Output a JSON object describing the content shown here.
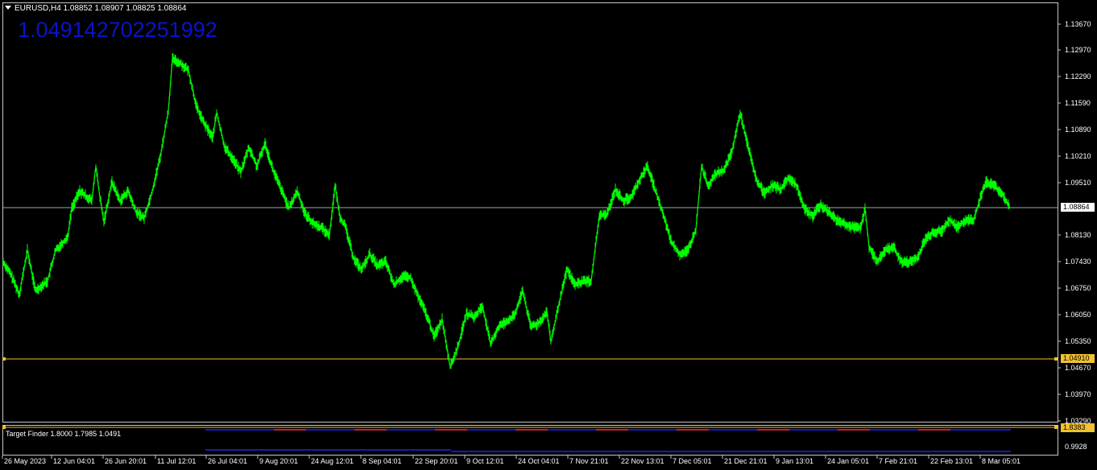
{
  "header": {
    "symbol_line": "EURUSD,H4  1.08852 1.08907 1.08825 1.08864",
    "big_value": "1.049142702251992"
  },
  "indicator": {
    "label": "Target Finder 1.8000 1.7985 1.0491"
  },
  "price_axis": {
    "labels": [
      "1.13670",
      "1.12970",
      "1.12290",
      "1.11590",
      "1.10890",
      "1.10210",
      "1.09510",
      "1.08130",
      "1.07430",
      "1.06750",
      "1.06050",
      "1.05350",
      "1.04670",
      "1.03970",
      "1.03290"
    ],
    "current_price": "1.08864",
    "target_price": "1.04910",
    "sub_tag": "1.8383",
    "sub_low": "0.9928"
  },
  "time_axis": {
    "labels": [
      "26 May 2023",
      "12 Jun 04:01",
      "26 Jun 20:01",
      "11 Jul 12:01",
      "26 Jul 04:01",
      "9 Aug 20:01",
      "24 Aug 12:01",
      "8 Sep 04:01",
      "22 Sep 20:01",
      "9 Oct 12:01",
      "24 Oct 04:01",
      "7 Nov 21:01",
      "22 Nov 13:01",
      "7 Dec 05:01",
      "21 Dec 21:01",
      "9 Jan 13:01",
      "24 Jan 05:01",
      "7 Feb 21:01",
      "22 Feb 13:01",
      "8 Mar 05:01"
    ]
  },
  "colors": {
    "background": "#000000",
    "price_line": "#00ff00",
    "current_line": "#a0a8b0",
    "target_line": "#f2c12e",
    "big_value": "#0a14c8",
    "indicator_blue": "#2020ff",
    "indicator_red": "#ff2020"
  },
  "chart_data": {
    "type": "line",
    "title": "EURUSD,H4",
    "series": [
      {
        "values": [
          [
            0,
            1.0745
          ],
          [
            10,
            1.071
          ],
          [
            20,
            1.066
          ],
          [
            30,
            1.0775
          ],
          [
            40,
            1.067
          ],
          [
            55,
            1.0695
          ],
          [
            65,
            1.0775
          ],
          [
            80,
            1.081
          ],
          [
            85,
            1.0885
          ],
          [
            95,
            1.093
          ],
          [
            110,
            1.0905
          ],
          [
            115,
            1.0995
          ],
          [
            120,
            1.0915
          ],
          [
            125,
            1.085
          ],
          [
            135,
            1.0955
          ],
          [
            145,
            1.0905
          ],
          [
            155,
            1.093
          ],
          [
            165,
            1.0875
          ],
          [
            175,
            1.086
          ],
          [
            185,
            1.093
          ],
          [
            195,
            1.102
          ],
          [
            205,
            1.114
          ],
          [
            210,
            1.1275
          ],
          [
            220,
            1.1265
          ],
          [
            230,
            1.1245
          ],
          [
            240,
            1.115
          ],
          [
            250,
            1.1105
          ],
          [
            260,
            1.107
          ],
          [
            265,
            1.1135
          ],
          [
            275,
            1.1045
          ],
          [
            285,
            1.1015
          ],
          [
            295,
            1.098
          ],
          [
            305,
            1.1045
          ],
          [
            315,
            1.0995
          ],
          [
            325,
            1.1055
          ],
          [
            335,
            1.0985
          ],
          [
            345,
            1.0935
          ],
          [
            355,
            1.0885
          ],
          [
            365,
            1.093
          ],
          [
            375,
            1.087
          ],
          [
            385,
            1.0845
          ],
          [
            395,
            1.0835
          ],
          [
            405,
            1.0815
          ],
          [
            412,
            1.0945
          ],
          [
            418,
            1.0865
          ],
          [
            425,
            1.0835
          ],
          [
            435,
            1.0755
          ],
          [
            445,
            1.0725
          ],
          [
            455,
            1.0765
          ],
          [
            465,
            1.0735
          ],
          [
            475,
            1.0745
          ],
          [
            485,
            1.0685
          ],
          [
            495,
            1.0705
          ],
          [
            505,
            1.0705
          ],
          [
            515,
            1.0655
          ],
          [
            525,
            1.061
          ],
          [
            535,
            1.055
          ],
          [
            545,
            1.0595
          ],
          [
            555,
            1.047
          ],
          [
            565,
            1.0525
          ],
          [
            575,
            1.061
          ],
          [
            585,
            1.06
          ],
          [
            595,
            1.063
          ],
          [
            605,
            1.053
          ],
          [
            615,
            1.0575
          ],
          [
            625,
            1.059
          ],
          [
            635,
            1.0605
          ],
          [
            645,
            1.067
          ],
          [
            655,
            1.0575
          ],
          [
            665,
            1.0585
          ],
          [
            675,
            1.0615
          ],
          [
            680,
            1.0535
          ],
          [
            690,
            1.0635
          ],
          [
            700,
            1.0725
          ],
          [
            710,
            1.0685
          ],
          [
            720,
            1.0695
          ],
          [
            730,
            1.0695
          ],
          [
            740,
            1.0865
          ],
          [
            750,
            1.087
          ],
          [
            760,
            1.0935
          ],
          [
            770,
            1.0905
          ],
          [
            780,
            1.0915
          ],
          [
            790,
            1.096
          ],
          [
            800,
            1.0995
          ],
          [
            810,
            1.093
          ],
          [
            820,
            1.0865
          ],
          [
            830,
            1.0795
          ],
          [
            840,
            1.0765
          ],
          [
            850,
            1.0775
          ],
          [
            860,
            1.083
          ],
          [
            867,
            1.0995
          ],
          [
            875,
            1.0945
          ],
          [
            885,
            1.0975
          ],
          [
            895,
            1.0985
          ],
          [
            905,
            1.1035
          ],
          [
            915,
            1.1135
          ],
          [
            925,
            1.1045
          ],
          [
            935,
            1.096
          ],
          [
            945,
            1.0925
          ],
          [
            955,
            1.0945
          ],
          [
            965,
            1.0935
          ],
          [
            975,
            1.0965
          ],
          [
            985,
            1.0945
          ],
          [
            995,
            1.0885
          ],
          [
            1005,
            1.0865
          ],
          [
            1015,
            1.0895
          ],
          [
            1025,
            1.0875
          ],
          [
            1035,
            1.0855
          ],
          [
            1045,
            1.0845
          ],
          [
            1055,
            1.0835
          ],
          [
            1065,
            1.0835
          ],
          [
            1070,
            1.0885
          ],
          [
            1075,
            1.0785
          ],
          [
            1085,
            1.0745
          ],
          [
            1095,
            1.0775
          ],
          [
            1105,
            1.0785
          ],
          [
            1115,
            1.0745
          ],
          [
            1125,
            1.0745
          ],
          [
            1135,
            1.0755
          ],
          [
            1145,
            1.0805
          ],
          [
            1155,
            1.0825
          ],
          [
            1165,
            1.0825
          ],
          [
            1175,
            1.0855
          ],
          [
            1185,
            1.0835
          ],
          [
            1195,
            1.0855
          ],
          [
            1205,
            1.0855
          ],
          [
            1215,
            1.0925
          ],
          [
            1220,
            1.0955
          ],
          [
            1230,
            1.0945
          ],
          [
            1240,
            1.0925
          ],
          [
            1245,
            1.0905
          ],
          [
            1250,
            1.0885
          ]
        ]
      }
    ],
    "ylim": [
      1.0329,
      1.1367
    ],
    "current_price": 1.08864,
    "target_price": 1.0491
  }
}
